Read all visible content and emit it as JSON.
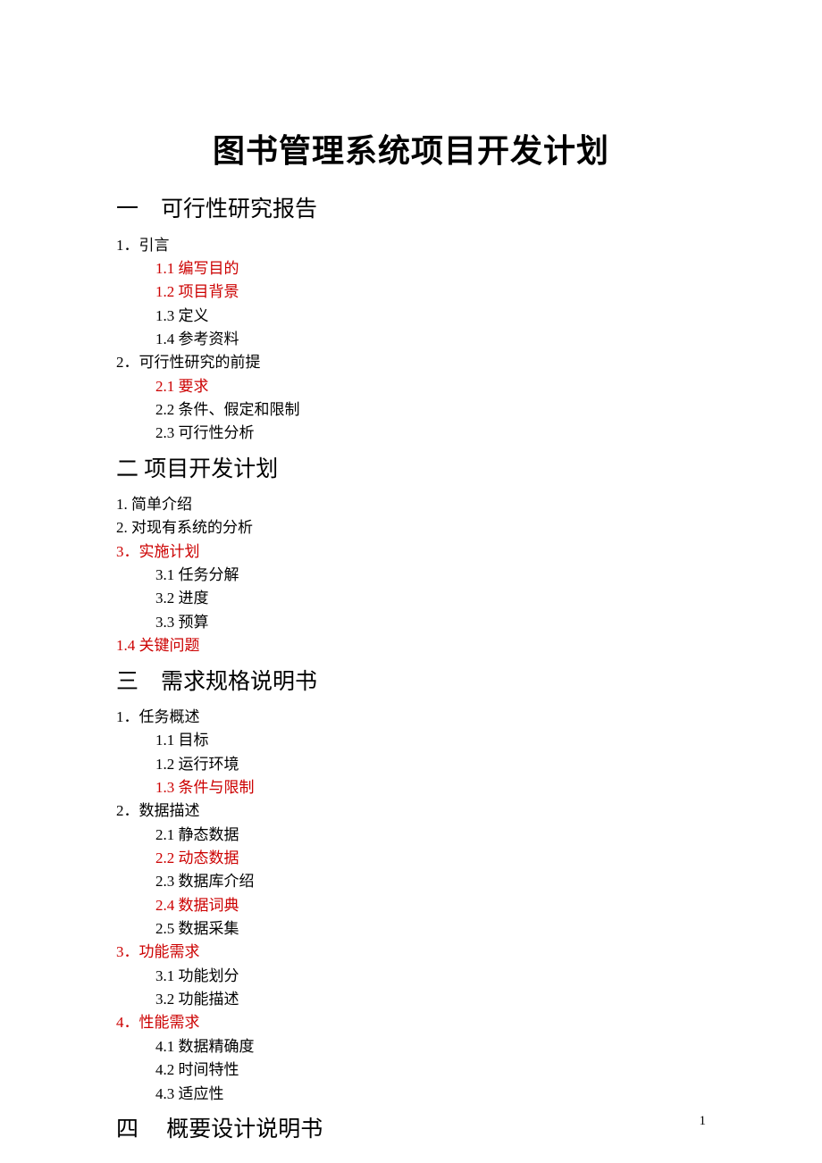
{
  "title": "图书管理系统项目开发计划",
  "sections": [
    {
      "heading": "一　可行性研究报告",
      "items": [
        {
          "text": "1．引言",
          "level": 1,
          "color": "black"
        },
        {
          "text": "1.1 编写目的",
          "level": 2,
          "color": "red"
        },
        {
          "text": "1.2 项目背景",
          "level": 2,
          "color": "red"
        },
        {
          "text": "1.3 定义",
          "level": 2,
          "color": "black"
        },
        {
          "text": "1.4 参考资料",
          "level": 2,
          "color": "black"
        },
        {
          "text": "2．可行性研究的前提",
          "level": 1,
          "color": "black"
        },
        {
          "text": "2.1 要求",
          "level": 2,
          "color": "red"
        },
        {
          "text": "2.2 条件、假定和限制",
          "level": 2,
          "color": "black"
        },
        {
          "text": "2.3 可行性分析",
          "level": 2,
          "color": "black"
        }
      ]
    },
    {
      "heading": "二  项目开发计划",
      "items": [
        {
          "text": "1. 简单介绍",
          "level": 1,
          "color": "black"
        },
        {
          "text": "2. 对现有系统的分析",
          "level": 1,
          "color": "black"
        },
        {
          "text": "3．实施计划",
          "level": 1,
          "color": "red"
        },
        {
          "text": "3.1 任务分解",
          "level": 2,
          "color": "black"
        },
        {
          "text": "3.2 进度",
          "level": 2,
          "color": "black"
        },
        {
          "text": "3.3 预算",
          "level": 2,
          "color": "black"
        },
        {
          "text": "1.4 关键问题",
          "level": 1,
          "color": "red"
        }
      ]
    },
    {
      "heading": "三　需求规格说明书",
      "items": [
        {
          "text": "1．任务概述",
          "level": 1,
          "color": "black"
        },
        {
          "text": "1.1 目标",
          "level": 2,
          "color": "black"
        },
        {
          "text": "1.2 运行环境",
          "level": 2,
          "color": "black"
        },
        {
          "text": "1.3 条件与限制",
          "level": 2,
          "color": "red"
        },
        {
          "text": "2．数据描述",
          "level": 1,
          "color": "black"
        },
        {
          "text": "2.1 静态数据",
          "level": 2,
          "color": "black"
        },
        {
          "text": "2.2 动态数据",
          "level": 2,
          "color": "red"
        },
        {
          "text": "2.3 数据库介绍",
          "level": 2,
          "color": "black"
        },
        {
          "text": "2.4 数据词典",
          "level": 2,
          "color": "red"
        },
        {
          "text": "2.5 数据采集",
          "level": 2,
          "color": "black"
        },
        {
          "text": "3．功能需求",
          "level": 1,
          "color": "red"
        },
        {
          "text": "3.1 功能划分",
          "level": 2,
          "color": "black"
        },
        {
          "text": "3.2 功能描述",
          "level": 2,
          "color": "black"
        },
        {
          "text": "4．性能需求",
          "level": 1,
          "color": "red"
        },
        {
          "text": "4.1 数据精确度",
          "level": 2,
          "color": "black"
        },
        {
          "text": "4.2 时间特性",
          "level": 2,
          "color": "black"
        },
        {
          "text": "4.3 适应性",
          "level": 2,
          "color": "black"
        }
      ]
    },
    {
      "heading": "四　 概要设计说明书",
      "items": []
    }
  ],
  "page_number": "1"
}
